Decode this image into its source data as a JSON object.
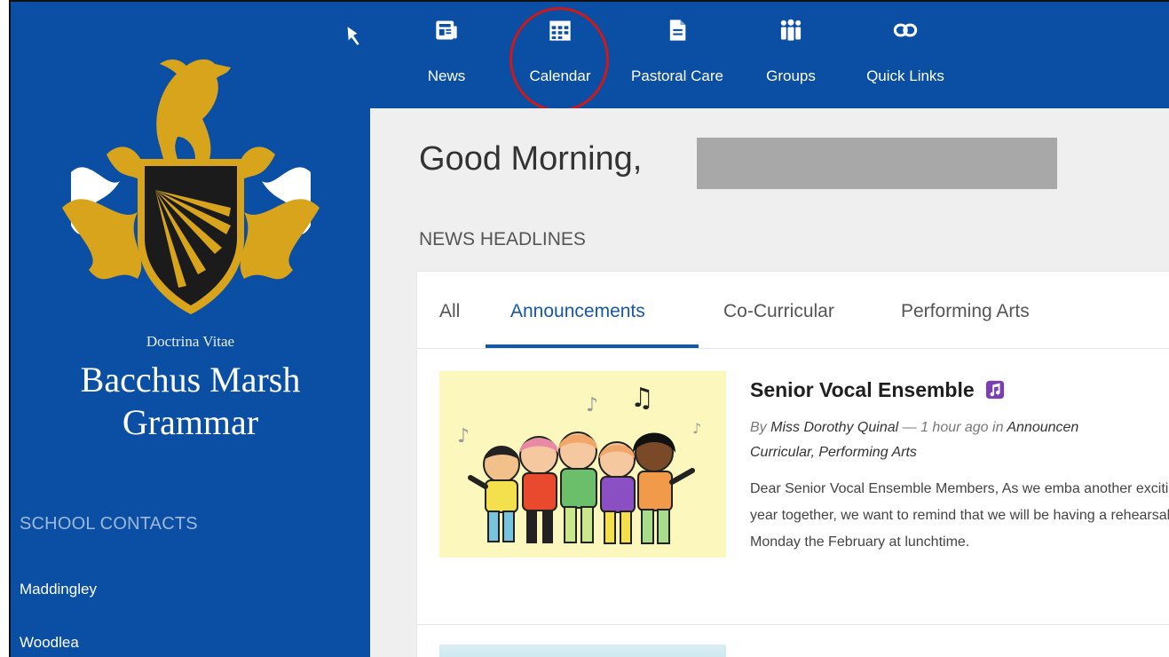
{
  "sidebar": {
    "motto": "Doctrina Vitae",
    "school_name_line1": "Bacchus Marsh",
    "school_name_line2": "Grammar",
    "contacts_heading": "SCHOOL CONTACTS",
    "contacts": [
      "Maddingley",
      "Woodlea"
    ],
    "pin_icon": "pin-icon",
    "crest_icon": "school-crest-logo"
  },
  "nav": {
    "items": [
      {
        "label": "News",
        "icon": "news-icon"
      },
      {
        "label": "Calendar",
        "icon": "calendar-icon"
      },
      {
        "label": "Pastoral Care",
        "icon": "document-icon"
      },
      {
        "label": "Groups",
        "icon": "groups-icon"
      },
      {
        "label": "Quick Links",
        "icon": "link-icon"
      }
    ],
    "highlighted": "Calendar"
  },
  "main": {
    "greeting": "Good Morning,",
    "news_heading": "NEWS HEADLINES",
    "tabs": [
      {
        "label": "All"
      },
      {
        "label": "Announcements"
      },
      {
        "label": "Co-Curricular"
      },
      {
        "label": "Performing Arts"
      }
    ],
    "active_tab": "Announcements",
    "article": {
      "title": "Senior Vocal Ensemble",
      "by": "By",
      "author": "Miss Dorothy Quinal",
      "time": "— 1 hour ago in",
      "categories_part1": "Announcen",
      "categories_part2": "Curricular, Performing Arts",
      "excerpt": "Dear Senior Vocal Ensemble Members, As we emba another exciting year together, we want to remind that we will be having a rehearsal this Monday the February at lunchtime."
    }
  },
  "colors": {
    "brand_blue": "#0a4fa3",
    "active_tab": "#1657a8",
    "crest_gold": "#d8a41c",
    "highlight_circle": "#d01818"
  }
}
